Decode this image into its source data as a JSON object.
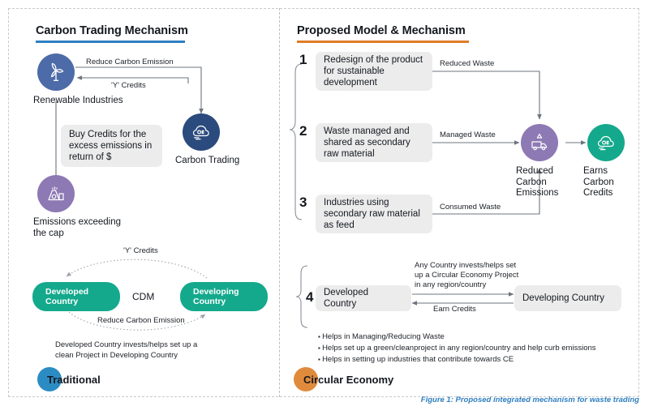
{
  "figure": {
    "caption": "Figure 1: Proposed integrated mechanism for waste trading",
    "caption_color": "#2e7fc1"
  },
  "left_panel": {
    "title": "Carbon Trading Mechanism",
    "rule_color": "#2e7fc1",
    "nodes": {
      "renewable": {
        "label": "Renewable Industries",
        "icon": "wind-turbine-icon",
        "color": "#4d6ba8"
      },
      "carbon_trading": {
        "label": "Carbon Trading",
        "icon": "co2-cloud-icon",
        "color": "#2b4a7d"
      },
      "emissions": {
        "label": "Emissions exceeding\nthe cap",
        "icon": "factory-icon",
        "color": "#8d79b3"
      }
    },
    "buy_credits_box": "Buy Credits for the excess emissions in return of $",
    "arrow_labels": {
      "reduce_emission": "Reduce Carbon Emission",
      "y_credits": "'Y' Credits"
    },
    "cdm": {
      "developed": "Developed\nCountry",
      "developing": "Developing\nCountry",
      "center_label": "CDM",
      "top_arc_label": "'Y' Credits",
      "bottom_arc_label": "Reduce Carbon Emission",
      "note": "Developed Country invests/helps set up a\nclean Project in Developing Country",
      "pill_color": "#14a98c"
    },
    "badge": {
      "label": "Traditional",
      "color": "#2b8cc4"
    }
  },
  "right_panel": {
    "title": "Proposed Model & Mechanism",
    "rule_color": "#e07b27",
    "steps": [
      {
        "number": "1",
        "text": "Redesign of the product for sustainable development",
        "arrow_label": "Reduced Waste"
      },
      {
        "number": "2",
        "text": "Waste managed and shared as secondary raw material",
        "arrow_label": "Managed Waste"
      },
      {
        "number": "3",
        "text": "Industries using secondary raw material as feed",
        "arrow_label": "Consumed Waste"
      }
    ],
    "outcomes": {
      "reduced": {
        "label": "Reduced\nCarbon\nEmissions",
        "icon": "recycle-truck-icon",
        "color": "#8d79b3"
      },
      "earns": {
        "label": "Earns\nCarbon\nCredits",
        "icon": "co2-cloud-icon",
        "color": "#14a98c"
      }
    },
    "step4": {
      "number": "4",
      "developed": "Developed Country",
      "developing": "Developing Country",
      "top_arrow_label": "Any Country invests/helps set\nup a Circular Economy Project\nin any region/country",
      "bottom_arrow_label": "Earn Credits"
    },
    "bullets": [
      "Helps in Managing/Reducing Waste",
      "Helps set up a green/cleanproject in any region/country and help curb emissions",
      "Helps in setting up industries that contribute towards CE"
    ],
    "badge": {
      "label": "Circular Economy",
      "color": "#e08a3c"
    }
  }
}
